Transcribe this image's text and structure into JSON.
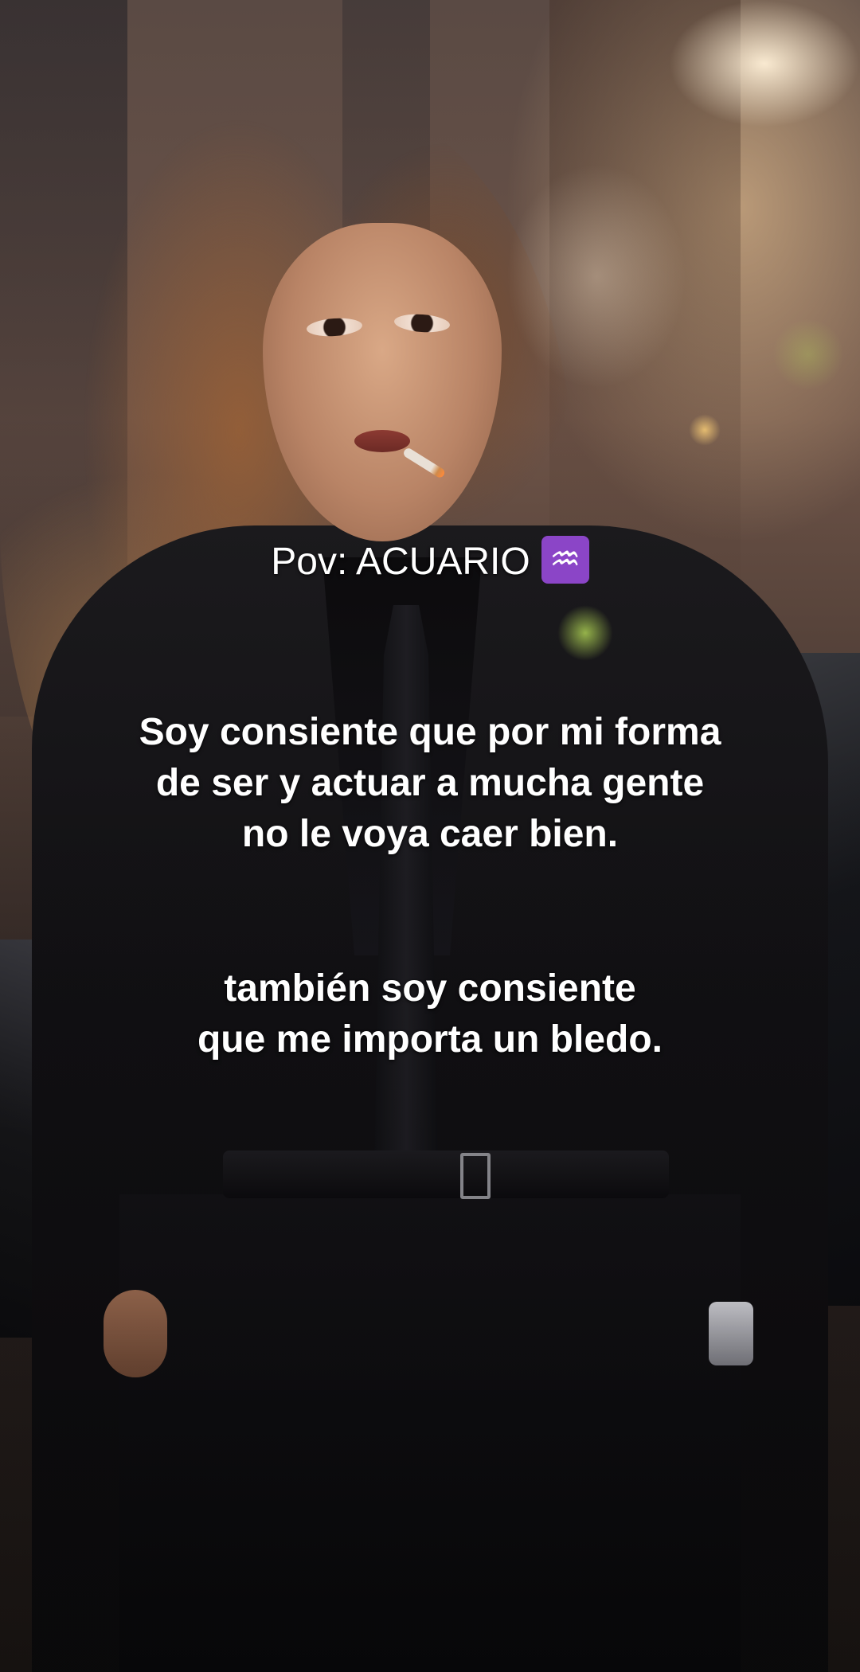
{
  "overlay_text": {
    "pov_label": "Pov: ACUARIO",
    "zodiac_symbol": "♒",
    "zodiac_icon": "aquarius-icon",
    "paragraph1": [
      "Soy consiente que por mi forma",
      "de ser y actuar a mucha gente",
      "no le voya caer bien."
    ],
    "paragraph2": [
      "también soy consiente",
      "que me importa un bledo."
    ]
  },
  "colors": {
    "text": "#ffffff",
    "zodiac_badge": "#8b45c7"
  }
}
